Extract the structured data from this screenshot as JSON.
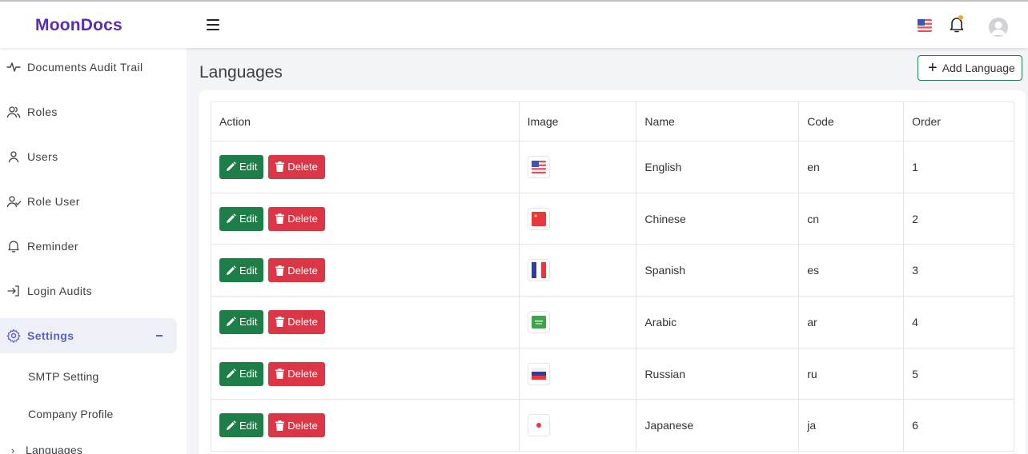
{
  "brand": "MoonDocs",
  "sidebar": {
    "items": [
      {
        "label": "Documents Audit Trail"
      },
      {
        "label": "Roles"
      },
      {
        "label": "Users"
      },
      {
        "label": "Role User"
      },
      {
        "label": "Reminder"
      },
      {
        "label": "Login Audits"
      },
      {
        "label": "Settings"
      }
    ],
    "sub_items": [
      {
        "label": "SMTP Setting"
      },
      {
        "label": "Company Profile"
      },
      {
        "label": "Languages"
      }
    ],
    "active": "Settings"
  },
  "page": {
    "title": "Languages",
    "add_button": "Add Language"
  },
  "table": {
    "headers": [
      "Action",
      "Image",
      "Name",
      "Code",
      "Order"
    ],
    "edit_label": "Edit",
    "delete_label": "Delete",
    "rows": [
      {
        "flag": "us-flag",
        "name": "English",
        "code": "en",
        "order": "1"
      },
      {
        "flag": "china-flag",
        "name": "Chinese",
        "code": "cn",
        "order": "2"
      },
      {
        "flag": "france-flag",
        "name": "Spanish",
        "code": "es",
        "order": "3"
      },
      {
        "flag": "saudi-flag",
        "name": "Arabic",
        "code": "ar",
        "order": "4"
      },
      {
        "flag": "russia-flag",
        "name": "Russian",
        "code": "ru",
        "order": "5"
      },
      {
        "flag": "japan-flag",
        "name": "Japanese",
        "code": "ja",
        "order": "6"
      }
    ]
  },
  "colors": {
    "brand": "#5b2bb4",
    "edit": "#1d7e47",
    "delete": "#dc3545",
    "active_nav": "#5b5fc7"
  }
}
